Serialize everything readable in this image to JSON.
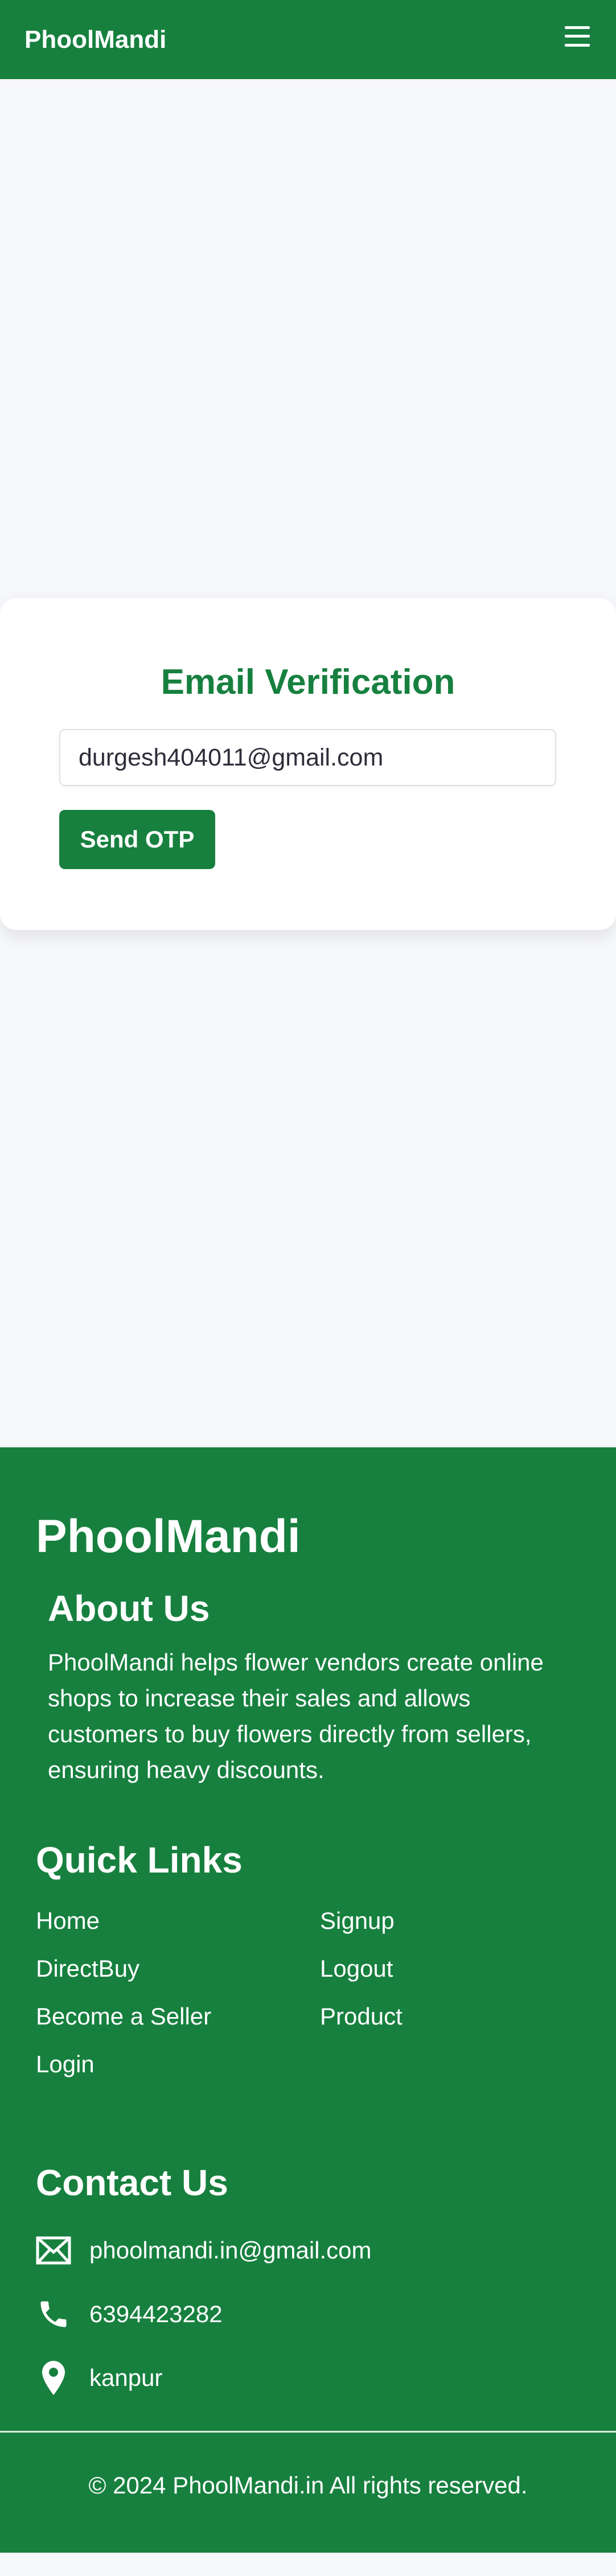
{
  "navbar": {
    "brand": "PhoolMandi",
    "menu_icon": "hamburger-menu-icon"
  },
  "verification": {
    "title": "Email Verification",
    "email_value": "durgesh404011@gmail.com",
    "send_button": "Send OTP"
  },
  "footer": {
    "brand": "PhoolMandi",
    "about": {
      "title": "About Us",
      "text": "PhoolMandi helps flower vendors create online shops to increase their sales and allows customers to buy flowers directly from sellers, ensuring heavy discounts."
    },
    "quick_links": {
      "title": "Quick Links",
      "items": [
        "Home",
        "Signup",
        "DirectBuy",
        "Logout",
        "Become a Seller",
        "Product",
        "Login"
      ]
    },
    "contact": {
      "title": "Contact Us",
      "email": "phoolmandi.in@gmail.com",
      "phone": "6394423282",
      "location": "kanpur",
      "icons": [
        "envelope-icon",
        "phone-icon",
        "location-pin-icon"
      ]
    },
    "copyright": "© 2024 PhoolMandi.in All rights reserved."
  },
  "colors": {
    "primary": "#17803f",
    "background": "#f7f8fb",
    "text_dark": "#2d2d3a"
  }
}
